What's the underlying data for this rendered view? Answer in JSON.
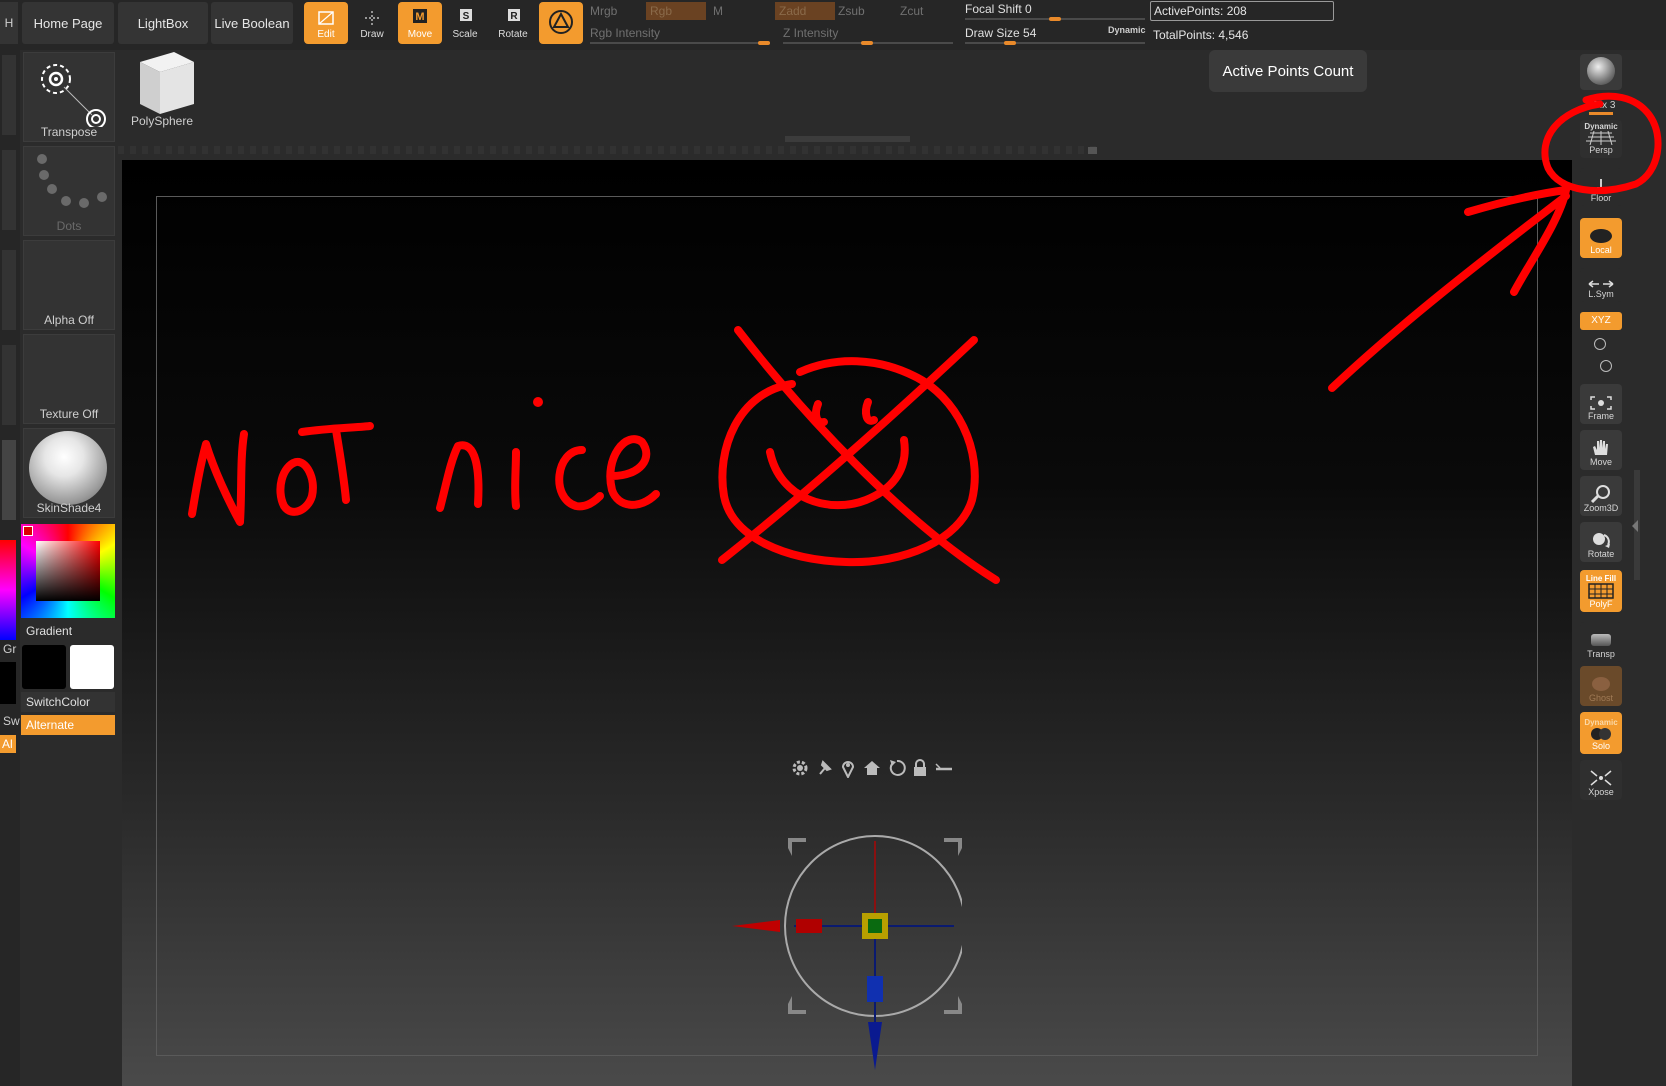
{
  "nav": {
    "home_page": "Home Page",
    "lightbox": "LightBox",
    "live_boolean": "Live Boolean",
    "left_edge_letter": "H"
  },
  "toolbar": {
    "edit": "Edit",
    "draw": "Draw",
    "move": "Move",
    "scale": "Scale",
    "rotate": "Rotate"
  },
  "channels": {
    "mrgb": "Mrgb",
    "rgb": "Rgb",
    "m": "M",
    "zadd": "Zadd",
    "zsub": "Zsub",
    "zcut": "Zcut",
    "rgb_intensity": "Rgb Intensity",
    "z_intensity": "Z Intensity"
  },
  "brush": {
    "focal_shift_label": "Focal Shift",
    "focal_shift_value": "0",
    "draw_size_label": "Draw Size",
    "draw_size_value": "54",
    "dynamic_label": "Dynamic"
  },
  "stats": {
    "active_points": "ActivePoints: 208",
    "total_points": "TotalPoints: 4,546"
  },
  "tooltip": "Active Points Count",
  "left_shelf": {
    "transpose": "Transpose",
    "polysphere": "PolySphere",
    "dots": "Dots",
    "alpha_off": "Alpha Off",
    "texture_off": "Texture Off",
    "material": "SkinShade4",
    "gradient": "Gradient",
    "switch_color": "SwitchColor",
    "alternate": "Alternate",
    "edge_gr": "Gr",
    "edge_sw": "Sw",
    "edge_al": "Al"
  },
  "right_shelf": {
    "spix": "SPix 3",
    "dynamic": "Dynamic",
    "persp": "Persp",
    "floor": "Floor",
    "local": "Local",
    "lsym": "L.Sym",
    "xyz": "XYZ",
    "frame": "Frame",
    "move": "Move",
    "zoom3d": "Zoom3D",
    "rotate": "Rotate",
    "line_fill": "Line Fill",
    "polyf": "PolyF",
    "transp": "Transp",
    "ghost": "Ghost",
    "solo_dynamic": "Dynamic",
    "solo": "Solo",
    "xpose": "Xpose"
  },
  "annotation": {
    "text": "NOT nice",
    "color": "#ff0000"
  },
  "colors": {
    "accent": "#f39b2e",
    "panel": "#2b2b2b",
    "button": "#343434"
  }
}
